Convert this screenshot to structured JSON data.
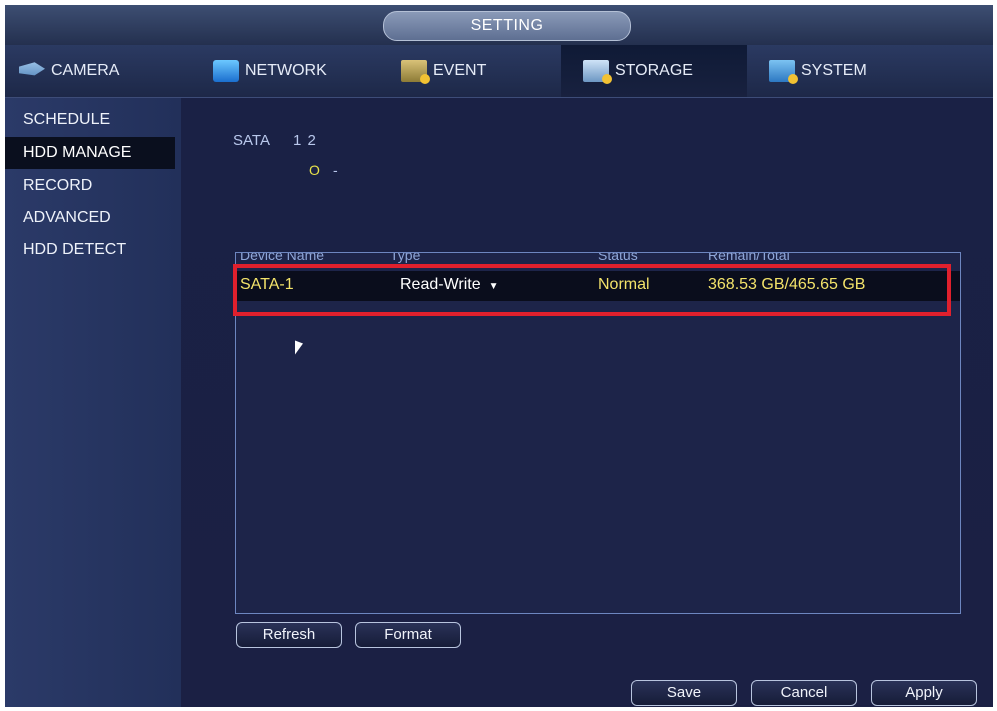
{
  "window": {
    "title": "SETTING"
  },
  "tabs": [
    {
      "label": "CAMERA",
      "icon": "camera-icon"
    },
    {
      "label": "NETWORK",
      "icon": "network-icon"
    },
    {
      "label": "EVENT",
      "icon": "event-icon"
    },
    {
      "label": "STORAGE",
      "icon": "storage-icon",
      "active": true
    },
    {
      "label": "SYSTEM",
      "icon": "system-icon"
    }
  ],
  "sidebar": {
    "items": [
      {
        "label": "SCHEDULE"
      },
      {
        "label": "HDD MANAGE",
        "active": true
      },
      {
        "label": "RECORD"
      },
      {
        "label": "ADVANCED"
      },
      {
        "label": "HDD DETECT"
      }
    ]
  },
  "sata": {
    "label": "SATA",
    "ports": "1  2",
    "status_1": "O",
    "status_2": "-"
  },
  "table": {
    "headers": [
      "Device Name",
      "Type",
      "Status",
      "Remain/Total"
    ],
    "rows": [
      {
        "device": "SATA-1",
        "type": "Read-Write",
        "status": "Normal",
        "remain_total": "368.53 GB/465.65 GB"
      }
    ]
  },
  "buttons": {
    "refresh": "Refresh",
    "format": "Format",
    "save": "Save",
    "cancel": "Cancel",
    "apply": "Apply"
  },
  "colors": {
    "highlight": "#e0202d",
    "row_text": "#f3e36a",
    "background": "#1c2247"
  }
}
